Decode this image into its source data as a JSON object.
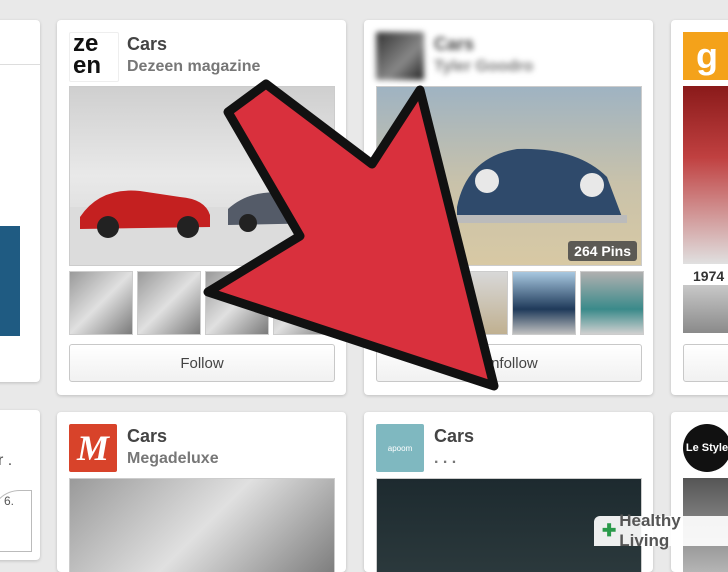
{
  "boards": [
    {
      "title": "Cars",
      "owner": "Dezeen magazine",
      "logo_text_line1": "ze",
      "logo_text_line2": "en",
      "button_label": "Follow"
    },
    {
      "title": "Cars",
      "owner": "Tyler Goodro",
      "pins_label": "264 Pins",
      "button_label": "Unfollow"
    },
    {
      "title": "Cars",
      "owner": "Megadeluxe",
      "logo_text": "M"
    },
    {
      "title": "Cars",
      "owner": ". . .",
      "logo_text": "apoom"
    }
  ],
  "right_column": {
    "logo_letter": "g",
    "year_text": "1974",
    "style_logo_text": "Le Style"
  },
  "left_column": {
    "partial_text": "r .",
    "partial_number": "6."
  },
  "watermark": {
    "label": "Healthy Living",
    "symbol": "✚"
  },
  "colors": {
    "arrow_red": "#d9303d",
    "arrow_outline": "#111111",
    "megadeluxe_red": "#d8432a",
    "blue_panel": "#1f5b82"
  }
}
